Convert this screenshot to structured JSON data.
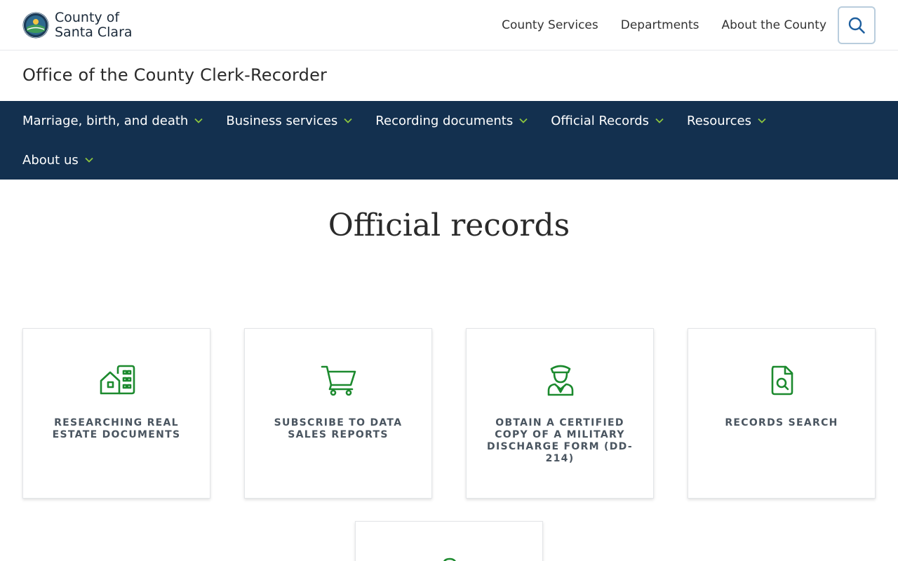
{
  "header": {
    "logo_line1": "County of",
    "logo_line2": "Santa Clara",
    "nav": [
      "County Services",
      "Departments",
      "About the County"
    ],
    "search_icon": "search-icon"
  },
  "office": {
    "title": "Office of the County Clerk-Recorder"
  },
  "main_nav": {
    "items": [
      {
        "label": "Marriage, birth, and death"
      },
      {
        "label": "Business services"
      },
      {
        "label": "Recording documents"
      },
      {
        "label": "Official Records"
      },
      {
        "label": "Resources"
      },
      {
        "label": "About us"
      }
    ]
  },
  "page": {
    "title": "Official records"
  },
  "cards": [
    {
      "label": "Researching real estate documents",
      "icon": "buildings-icon"
    },
    {
      "label": "Subscribe to data sales reports",
      "icon": "shopping-cart-icon"
    },
    {
      "label": "Obtain a certified copy of a military discharge form (DD-214)",
      "icon": "military-person-icon"
    },
    {
      "label": "Records search",
      "icon": "document-search-icon"
    },
    {
      "label": "",
      "icon": "location-pin-icon"
    }
  ],
  "colors": {
    "nav_background": "#13304f",
    "icon_green": "#1c8a2e",
    "chevron_green": "#8dc63f",
    "search_blue": "#1e5f9e"
  }
}
